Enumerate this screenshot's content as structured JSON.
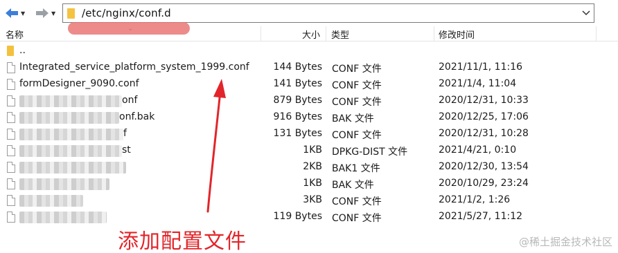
{
  "toolbar": {
    "path": "/etc/nginx/conf.d"
  },
  "header": {
    "name": "名称",
    "size": "大小",
    "type": "类型",
    "modified": "修改时间"
  },
  "rows": [
    {
      "name": "..",
      "size": "",
      "type": "",
      "modified": ""
    },
    {
      "name": "Integrated_service_platform_system_1999.conf",
      "size": "144 Bytes",
      "type": "CONF 文件",
      "modified": "2021/11/1, 11:16"
    },
    {
      "name": "formDesigner_9090.conf",
      "size": "141 Bytes",
      "type": "CONF 文件",
      "modified": "2021/1/4, 11:04"
    },
    {
      "name": "onf",
      "size": "879 Bytes",
      "type": "CONF 文件",
      "modified": "2020/12/31, 10:33"
    },
    {
      "name": "onf.bak",
      "size": "916 Bytes",
      "type": "BAK 文件",
      "modified": "2020/12/25, 17:06"
    },
    {
      "name": "f",
      "size": "131 Bytes",
      "type": "CONF 文件",
      "modified": "2020/12/31, 10:28"
    },
    {
      "name": "st",
      "size": "1KB",
      "type": "DPKG-DIST 文件",
      "modified": "2021/4/21, 0:10"
    },
    {
      "name": "",
      "size": "2KB",
      "type": "BAK1 文件",
      "modified": "2020/12/30, 13:54"
    },
    {
      "name": "",
      "size": "1KB",
      "type": "BAK 文件",
      "modified": "2020/10/29, 23:24"
    },
    {
      "name": "",
      "size": "3KB",
      "type": "CONF 文件",
      "modified": "2021/1/2, 1:26"
    },
    {
      "name": "",
      "size": "119 Bytes",
      "type": "CONF 文件",
      "modified": "2021/5/27, 11:12"
    }
  ],
  "annotation": "添加配置文件",
  "watermark": "@稀土掘金技术社区",
  "colors": {
    "annotation": "#e2252a",
    "highlight": "#e86e6e",
    "nav_blue": "#3d7fd8"
  }
}
